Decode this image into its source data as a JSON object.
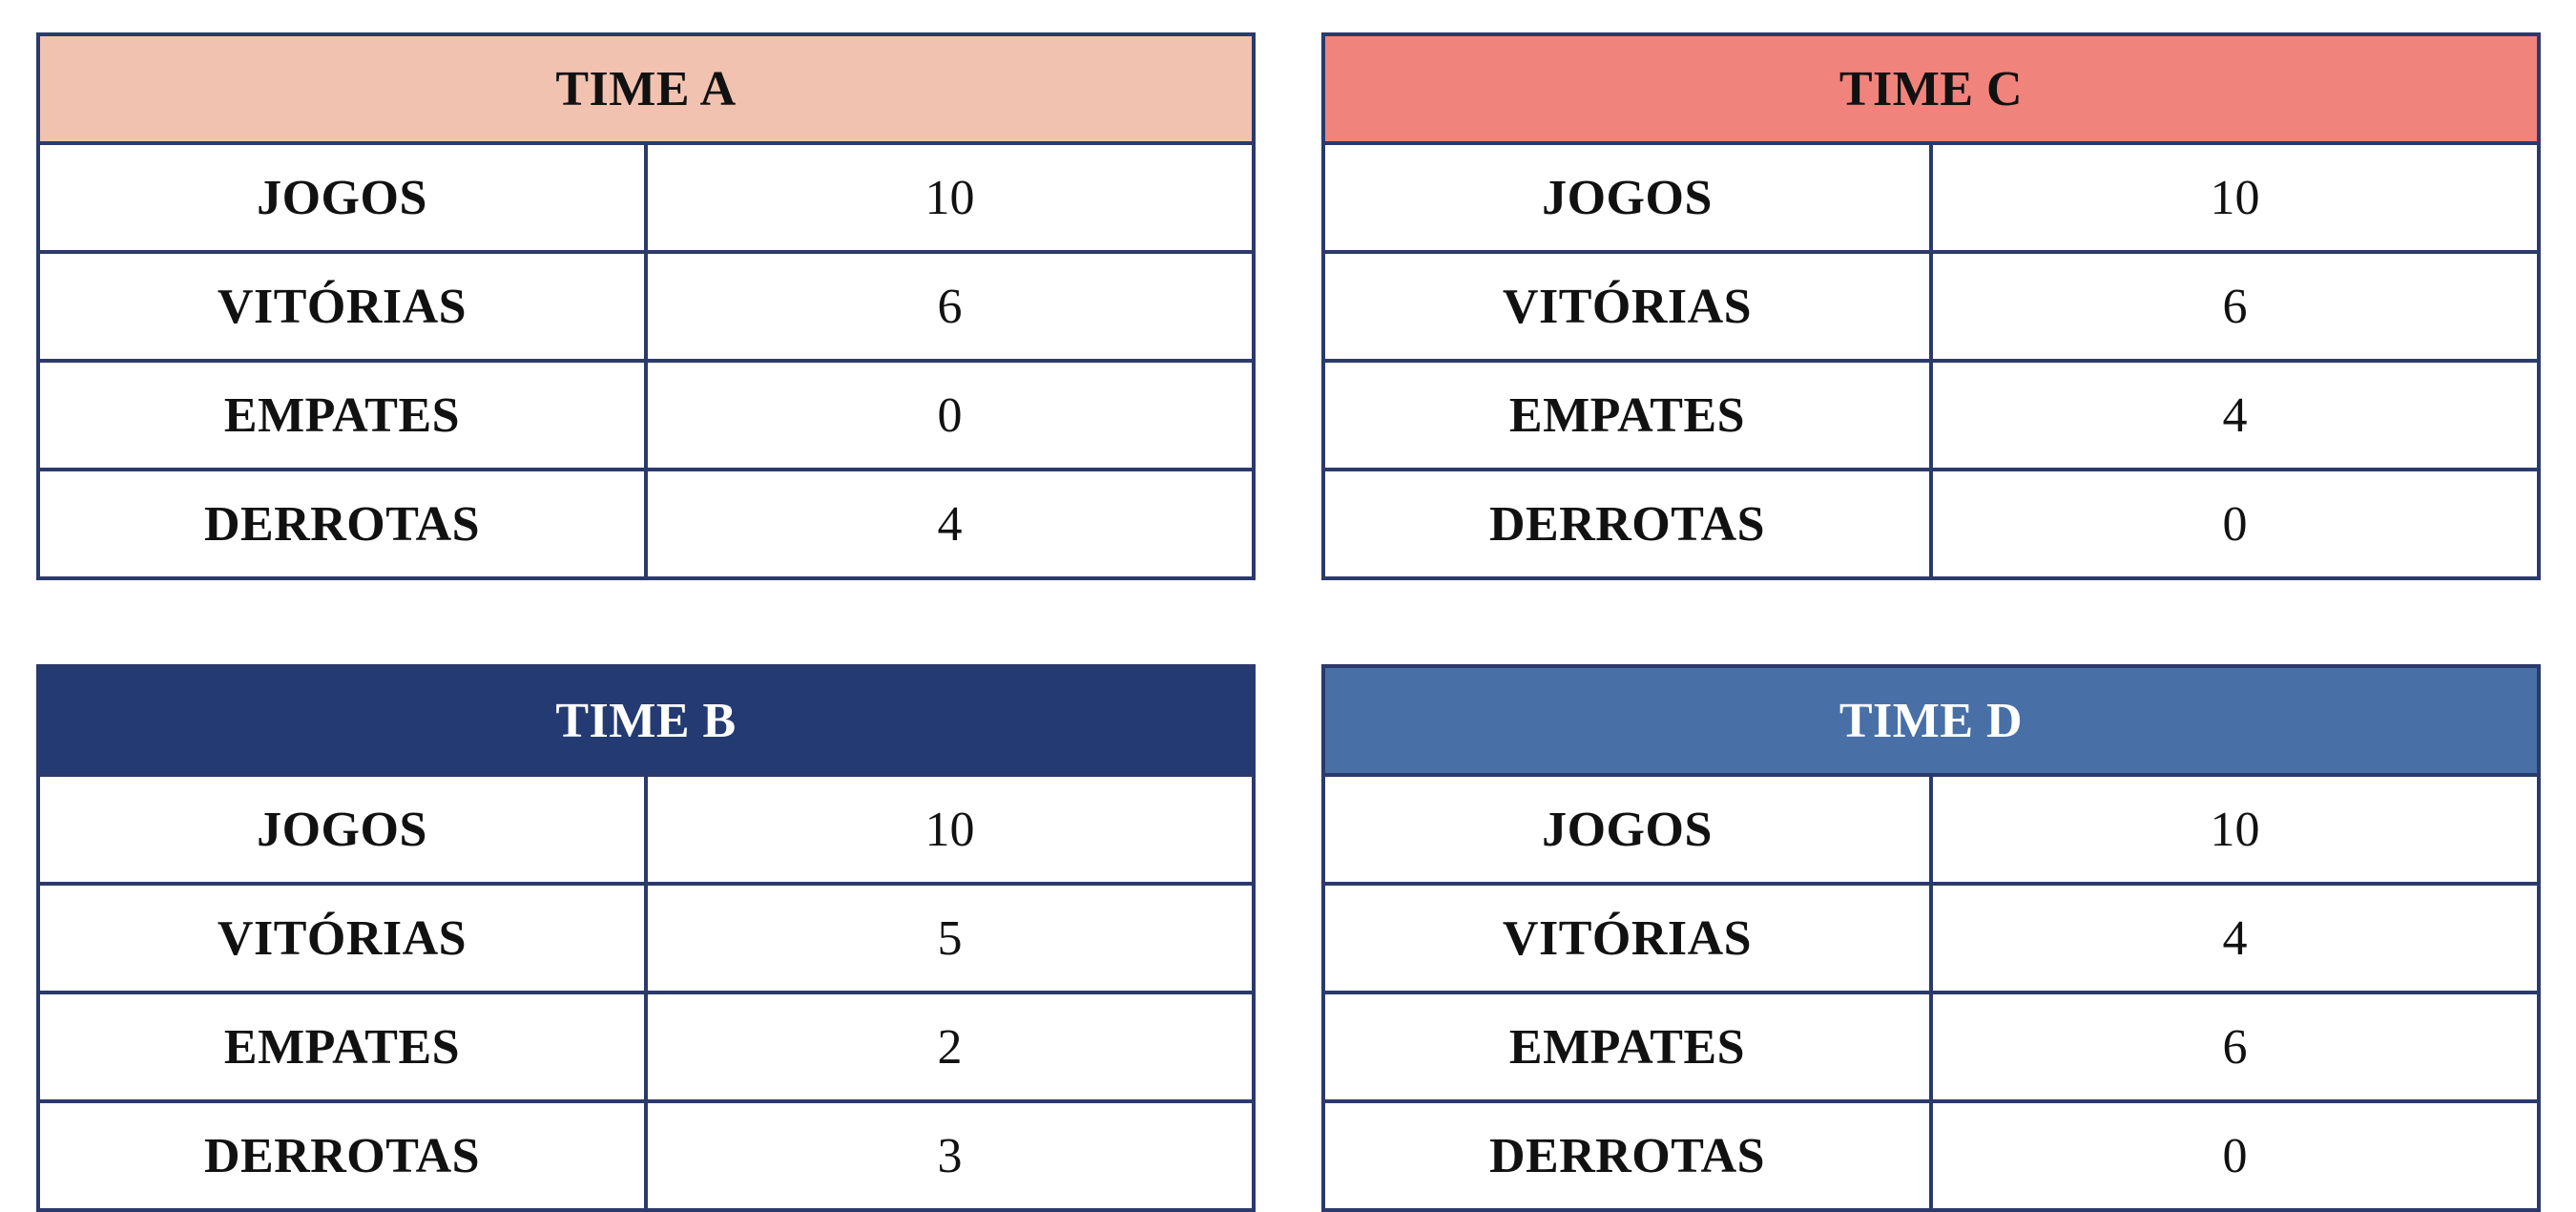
{
  "colors": {
    "border": "#2b3a6b",
    "team_a_header": "#f2c2b0",
    "team_c_header": "#f0837b",
    "team_b_header": "#243a73",
    "team_d_header": "#4870a7"
  },
  "labels": {
    "games": "JOGOS",
    "wins": "VITÓRIAS",
    "draws": "EMPATES",
    "losses": "DERROTAS"
  },
  "teams": {
    "a": {
      "name": "TIME A",
      "games": "10",
      "wins": "6",
      "draws": "0",
      "losses": "4"
    },
    "c": {
      "name": "TIME C",
      "games": "10",
      "wins": "6",
      "draws": "4",
      "losses": "0"
    },
    "b": {
      "name": "TIME B",
      "games": "10",
      "wins": "5",
      "draws": "2",
      "losses": "3"
    },
    "d": {
      "name": "TIME D",
      "games": "10",
      "wins": "4",
      "draws": "6",
      "losses": "0"
    }
  }
}
